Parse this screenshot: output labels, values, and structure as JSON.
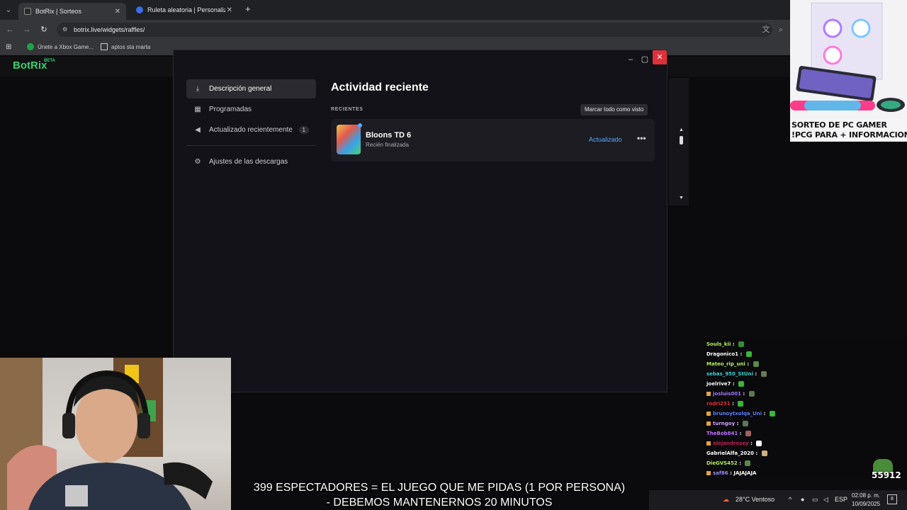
{
  "browser": {
    "tabs": [
      {
        "title": "BotRix | Sorteos",
        "active": true
      },
      {
        "title": "Ruleta aleatoria | Personaliza y",
        "active": false
      }
    ],
    "new_tab": "+",
    "url": "botrix.live/widgets/raffles/",
    "bookmarks": [
      "Únete a Xbox Game...",
      "aptos sta marta"
    ]
  },
  "botrix": {
    "logo": "BotRix",
    "beta": "BETA"
  },
  "promo": {
    "line1": "SORTEO DE PC GAMER",
    "line2": "!PCG PARA + INFORMACION"
  },
  "download_window": {
    "sidebar": [
      {
        "label": "Descripción general",
        "icon": "download-icon",
        "active": true
      },
      {
        "label": "Programadas",
        "icon": "calendar-icon",
        "active": false
      },
      {
        "label": "Actualizado recientemente",
        "icon": "megaphone-icon",
        "active": false,
        "badge": "1"
      },
      {
        "label": "Ajustes de las descargas",
        "icon": "gear-icon",
        "active": false
      }
    ],
    "title": "Actividad reciente",
    "section_label": "RECIENTES",
    "mark_all": "Marcar todo como visto",
    "items": [
      {
        "name": "Bloons TD 6",
        "status": "Recién finalizada",
        "state": "Actualizado",
        "more": "•••"
      }
    ]
  },
  "chat": [
    {
      "user": "Souls_kii",
      "color": "#b4f05a",
      "msg": ""
    },
    {
      "user": "Dragonico1",
      "color": "#ffffff",
      "msg": ""
    },
    {
      "user": "Mateo_rip_uni",
      "color": "#b4f05a",
      "msg": ""
    },
    {
      "user": "sebas_950_StUni",
      "color": "#3fd0d0",
      "msg": ""
    },
    {
      "user": "joelrive7",
      "color": "#ffffff",
      "msg": ""
    },
    {
      "user": "josluis001",
      "color": "#9b7bff",
      "msg": ""
    },
    {
      "user": "rodri231",
      "color": "#e03030",
      "msg": ""
    },
    {
      "user": "brunoytxolqa_Uni",
      "color": "#5a7bff",
      "msg": ""
    },
    {
      "user": "turngoy",
      "color": "#d0a0ff",
      "msg": ""
    },
    {
      "user": "TheBob841",
      "color": "#c070ff",
      "msg": ""
    },
    {
      "user": "alejandrosey",
      "color": "#c02050",
      "msg": ""
    },
    {
      "user": "GabrielAlfa_2020",
      "color": "#ffffff",
      "msg": ""
    },
    {
      "user": "DieGVS452",
      "color": "#b4f05a",
      "msg": ""
    },
    {
      "user": "saf86",
      "color": "#9a8cff",
      "msg": "JAJAJAJA"
    }
  ],
  "viewer_count": "55912",
  "caption": {
    "line1": "399 ESPECTADORES = EL JUEGO QUE ME PIDAS (1 POR PERSONA)",
    "line2": "- DEBEMOS MANTENERNOS 20 MINUTOS"
  },
  "taskbar": {
    "weather": "28°C  Ventoso",
    "lang": "ESP",
    "time": "02:08 p. m.",
    "date": "10/09/2025",
    "notif": "8"
  },
  "colors": {
    "accent": "#5aa8ff",
    "close": "#e0303a",
    "botrix": "#36d36a"
  }
}
